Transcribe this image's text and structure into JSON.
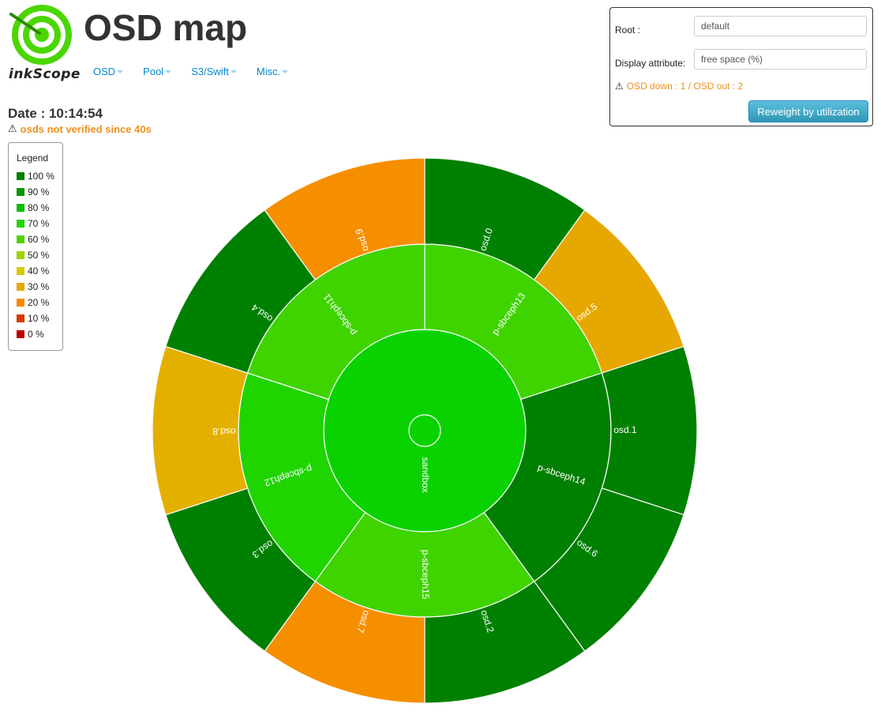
{
  "app": {
    "logo_text": "inkScope",
    "title": "OSD map"
  },
  "nav": {
    "items": [
      {
        "label": "OSD"
      },
      {
        "label": "Pool"
      },
      {
        "label": "S3/Swift"
      },
      {
        "label": "Misc."
      }
    ]
  },
  "status": {
    "date": "Date : 10:14:54",
    "warning": "osds not verified since 40s"
  },
  "legend": {
    "title": "Legend",
    "items": [
      {
        "label": "100 %",
        "color": "#008000"
      },
      {
        "label": "90 %",
        "color": "#0a9400"
      },
      {
        "label": "80 %",
        "color": "#0cbc00"
      },
      {
        "label": "70 %",
        "color": "#22d400"
      },
      {
        "label": "60 %",
        "color": "#50d200"
      },
      {
        "label": "50 %",
        "color": "#a0d000"
      },
      {
        "label": "40 %",
        "color": "#d4cc00"
      },
      {
        "label": "30 %",
        "color": "#e4a800"
      },
      {
        "label": "20 %",
        "color": "#f48a00"
      },
      {
        "label": "10 %",
        "color": "#d83800"
      },
      {
        "label": "0 %",
        "color": "#bb0000"
      }
    ]
  },
  "controls": {
    "root_label": "Root :",
    "root_value": "default",
    "display_label": "Display attribute:",
    "display_value": "free space (%)",
    "osd_status": "OSD down : 1 / OSD out : 2",
    "reweight_label": "Reweight by utilization"
  },
  "sunburst": {
    "root": {
      "name": "sandbox",
      "color": "#0ad200"
    },
    "hosts": [
      {
        "name": "p-sbceph13",
        "color": "#3fd400",
        "osds": [
          {
            "name": "osd.0",
            "color": "#008000"
          },
          {
            "name": "osd.5",
            "color": "#e6a800"
          }
        ]
      },
      {
        "name": "p-sbceph14",
        "color": "#008000",
        "osds": [
          {
            "name": "osd.1",
            "color": "#008000"
          },
          {
            "name": "osd.6",
            "color": "#008000"
          }
        ]
      },
      {
        "name": "p-sbceph15",
        "color": "#3fd400",
        "osds": [
          {
            "name": "osd.2",
            "color": "#008000"
          },
          {
            "name": "osd.7",
            "color": "#f68f00"
          }
        ]
      },
      {
        "name": "p-sbceph12",
        "color": "#20d400",
        "osds": [
          {
            "name": "osd.3",
            "color": "#008000"
          },
          {
            "name": "osd.8",
            "color": "#e4b000"
          }
        ]
      },
      {
        "name": "p-sbceph11",
        "color": "#3fd400",
        "osds": [
          {
            "name": "osd.4",
            "color": "#008000"
          },
          {
            "name": "osd.9",
            "color": "#f68f00"
          }
        ]
      }
    ]
  }
}
